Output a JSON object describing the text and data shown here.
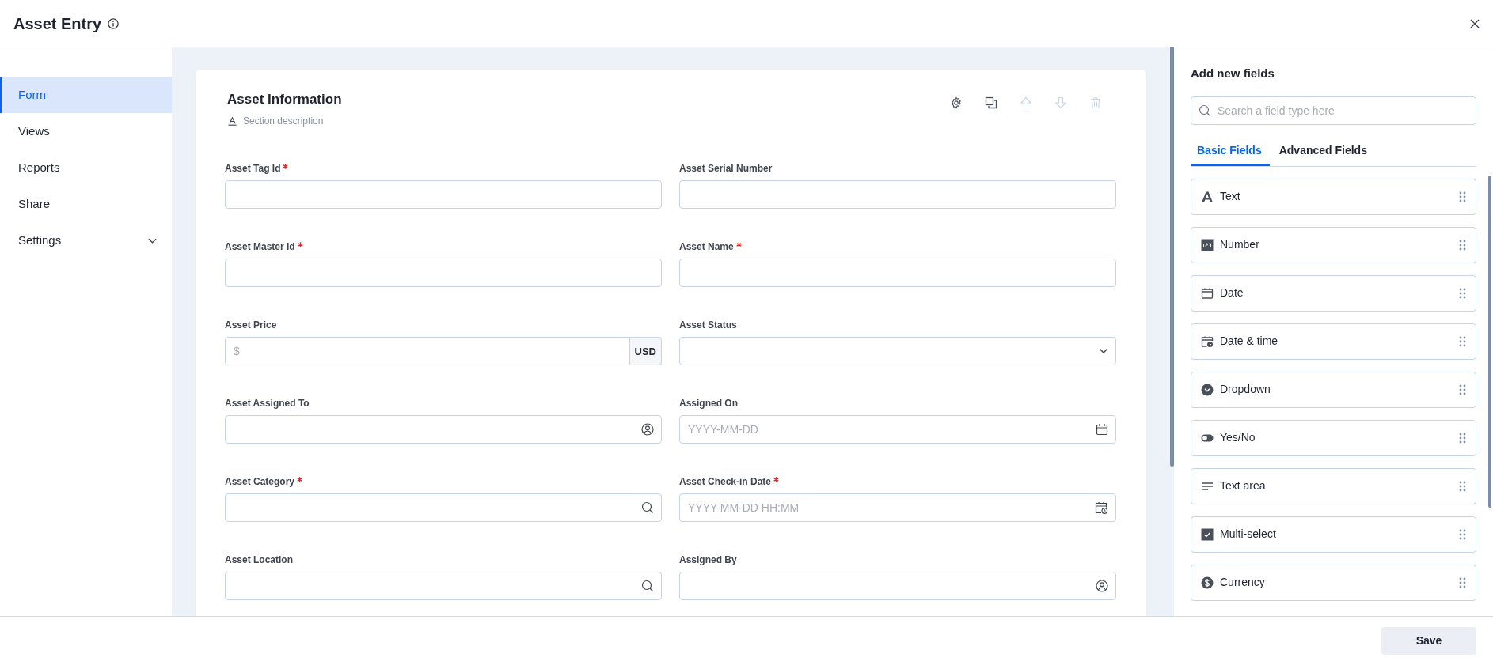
{
  "window": {
    "title": "Asset Entry"
  },
  "sidebar": {
    "items": [
      {
        "label": "Form",
        "selected": true,
        "kind": "link"
      },
      {
        "label": "Views",
        "selected": false,
        "kind": "link"
      },
      {
        "label": "Reports",
        "selected": false,
        "kind": "link"
      },
      {
        "label": "Share",
        "selected": false,
        "kind": "link"
      },
      {
        "label": "Settings",
        "selected": false,
        "kind": "group"
      }
    ]
  },
  "section": {
    "title": "Asset Information",
    "description": "Section description",
    "toolbar": [
      {
        "kind": "settings",
        "disabled": false
      },
      {
        "kind": "copy",
        "disabled": false
      },
      {
        "kind": "up",
        "disabled": true
      },
      {
        "kind": "down",
        "disabled": true
      },
      {
        "kind": "delete",
        "disabled": true
      }
    ],
    "fields": [
      {
        "label": "Asset Tag Id",
        "required": true,
        "kind": "text"
      },
      {
        "label": "Asset Serial Number",
        "required": false,
        "kind": "text"
      },
      {
        "label": "Asset Master Id",
        "required": true,
        "kind": "text"
      },
      {
        "label": "Asset Name",
        "required": true,
        "kind": "text"
      },
      {
        "label": "Asset Price",
        "required": false,
        "kind": "currency",
        "placeholder": "$",
        "addon": "USD"
      },
      {
        "label": "Asset Status",
        "required": false,
        "kind": "select"
      },
      {
        "label": "Asset Assigned To",
        "required": false,
        "kind": "user"
      },
      {
        "label": "Assigned On",
        "required": false,
        "kind": "date",
        "placeholder": "YYYY-MM-DD"
      },
      {
        "label": "Asset Category",
        "required": true,
        "kind": "lookup"
      },
      {
        "label": "Asset Check-in Date",
        "required": true,
        "kind": "datetime",
        "placeholder": "YYYY-MM-DD HH:MM"
      },
      {
        "label": "Asset Location",
        "required": false,
        "kind": "lookup"
      },
      {
        "label": "Assigned By",
        "required": false,
        "kind": "user"
      }
    ]
  },
  "panel": {
    "title": "Add new fields",
    "search": {
      "placeholder": "Search a field type here"
    },
    "tabs": [
      {
        "label": "Basic Fields",
        "selected": true
      },
      {
        "label": "Advanced Fields",
        "selected": false
      }
    ],
    "field_types": [
      {
        "label": "Text",
        "kind": "text"
      },
      {
        "label": "Number",
        "kind": "number"
      },
      {
        "label": "Date",
        "kind": "date"
      },
      {
        "label": "Date & time",
        "kind": "datetime"
      },
      {
        "label": "Dropdown",
        "kind": "dropdown"
      },
      {
        "label": "Yes/No",
        "kind": "toggle"
      },
      {
        "label": "Text area",
        "kind": "textarea"
      },
      {
        "label": "Multi-select",
        "kind": "checkbox"
      },
      {
        "label": "Currency",
        "kind": "currency"
      }
    ]
  },
  "footer": {
    "buttons": [
      "Save"
    ]
  }
}
